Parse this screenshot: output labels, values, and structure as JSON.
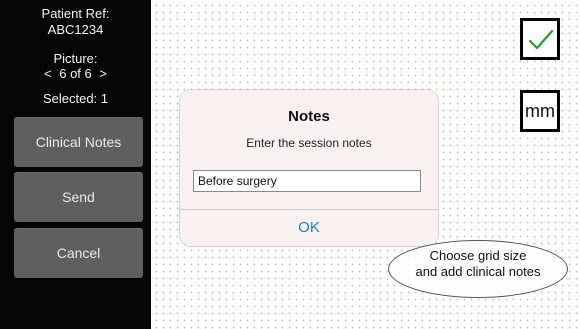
{
  "sidebar": {
    "patient_ref_label": "Patient Ref:",
    "patient_ref_value": "ABC1234",
    "picture_label": "Picture:",
    "picture_prev": "<",
    "picture_index": "6 of 6",
    "picture_next": ">",
    "selected_text": "Selected: 1",
    "buttons": {
      "clinical_notes": "Clinical Notes",
      "send": "Send",
      "cancel": "Cancel"
    }
  },
  "toolbar": {
    "confirm_icon": "checkmark-icon",
    "unit_label": "mm"
  },
  "dialog": {
    "title": "Notes",
    "message": "Enter the session notes",
    "input_value": "Before surgery",
    "ok_label": "OK"
  },
  "hint": {
    "line1": "Choose grid size",
    "line2": "and add clinical notes"
  },
  "colors": {
    "sidebar_bg": "#060606",
    "button_bg": "#5f5f5f",
    "confirm_green": "#1ea51e",
    "ok_blue": "#1a7cf0",
    "dialog_bg": "#f7f2ee"
  }
}
